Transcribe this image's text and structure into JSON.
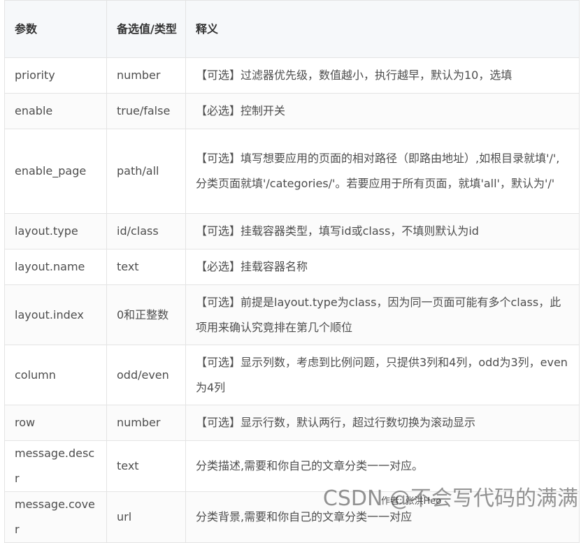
{
  "table": {
    "headers": [
      "参数",
      "备选值/类型",
      "释义"
    ],
    "rows": [
      {
        "param": "priority",
        "value": "number",
        "desc": "【可选】过滤器优先级，数值越小，执行越早，默认为10，选填"
      },
      {
        "param": "enable",
        "value": "true/false",
        "desc": "【必选】控制开关"
      },
      {
        "param": "enable_page",
        "value": "path/all",
        "desc": "【可选】填写想要应用的页面的相对路径（即路由地址）,如根目录就填'/',分类页面就填'/categories/'。若要应用于所有页面，就填'all'，默认为'/'"
      },
      {
        "param": "layout.type",
        "value": "id/class",
        "desc": "【可选】挂载容器类型，填写id或class，不填则默认为id"
      },
      {
        "param": "layout.name",
        "value": "text",
        "desc": "【必选】挂载容器名称"
      },
      {
        "param": "layout.index",
        "value": "0和正整数",
        "desc": "【可选】前提是layout.type为class，因为同一页面可能有多个class，此项用来确认究竟排在第几个顺位"
      },
      {
        "param": "column",
        "value": "odd/even",
        "desc": "【可选】显示列数，考虑到比例问题，只提供3列和4列，odd为3列，even为4列"
      },
      {
        "param": "row",
        "value": "number",
        "desc": "【可选】显示行数，默认两行，超过行数切换为滚动显示"
      },
      {
        "param": "message.descr",
        "value": "text",
        "desc": "分类描述,需要和你自己的文章分类一一对应。"
      },
      {
        "param": "message.cover",
        "value": "url",
        "desc": "分类背景,需要和你自己的文章分类一一对应"
      }
    ]
  },
  "watermark": {
    "main": "CSDN @不会写代码的满满",
    "author": "作者: 张洪Heo"
  }
}
